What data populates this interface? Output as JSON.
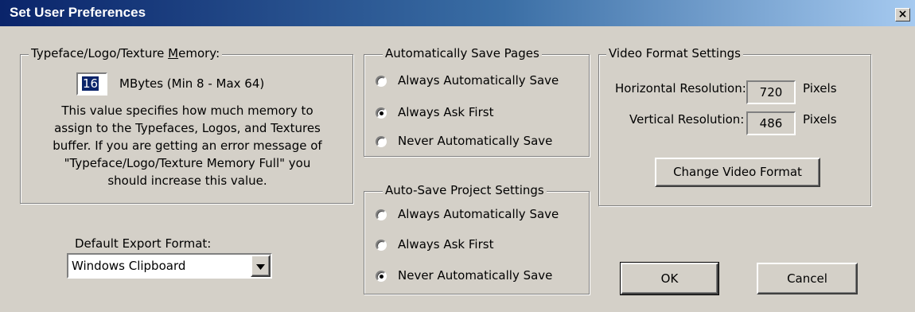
{
  "window": {
    "title": "Set User Preferences",
    "close_label": "×"
  },
  "memory": {
    "legend_prefix": "Typeface/Logo/Texture ",
    "legend_accel": "M",
    "legend_suffix": "emory:",
    "value": "16",
    "range_label": "MBytes (Min 8 - Max 64)",
    "description": [
      "This value specifies how much memory to",
      "assign to the Typefaces, Logos, and Textures",
      "buffer.  If you are getting an error message of",
      "\"Typeface/Logo/Texture Memory Full\" you",
      "should increase this value."
    ]
  },
  "export": {
    "label": "Default Export Format:",
    "value": "Windows Clipboard"
  },
  "autosave_pages": {
    "legend": "Automatically Save Pages",
    "options": [
      "Always Automatically Save",
      "Always Ask First",
      "Never Automatically Save"
    ],
    "selected_index": 1
  },
  "autosave_project": {
    "legend": "Auto-Save Project Settings",
    "options": [
      "Always Automatically Save",
      "Always Ask First",
      "Never Automatically Save"
    ],
    "selected_index": 2
  },
  "video": {
    "legend": "Video Format Settings",
    "horizontal_label": "Horizontal Resolution:",
    "horizontal_value": "720",
    "vertical_label": "Vertical Resolution:",
    "vertical_value": "486",
    "unit": "Pixels",
    "change_button": "Change Video Format"
  },
  "buttons": {
    "ok": "OK",
    "cancel": "Cancel"
  }
}
